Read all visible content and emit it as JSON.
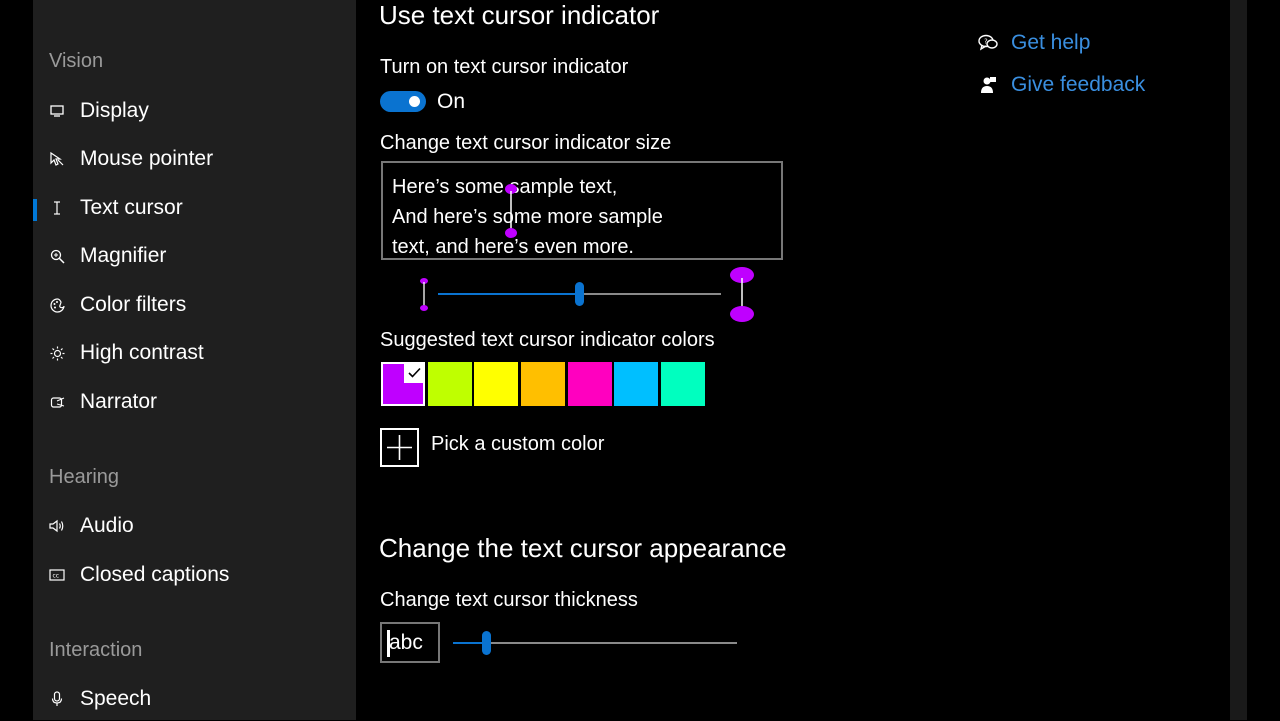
{
  "sidebar": {
    "sections": [
      {
        "title": "Vision",
        "items": [
          {
            "label": "Display",
            "icon": "display-icon"
          },
          {
            "label": "Mouse pointer",
            "icon": "mouse-pointer-icon"
          },
          {
            "label": "Text cursor",
            "icon": "text-cursor-icon",
            "active": true
          },
          {
            "label": "Magnifier",
            "icon": "magnifier-icon"
          },
          {
            "label": "Color filters",
            "icon": "color-filters-icon"
          },
          {
            "label": "High contrast",
            "icon": "high-contrast-icon"
          },
          {
            "label": "Narrator",
            "icon": "narrator-icon"
          }
        ]
      },
      {
        "title": "Hearing",
        "items": [
          {
            "label": "Audio",
            "icon": "audio-icon"
          },
          {
            "label": "Closed captions",
            "icon": "closed-captions-icon"
          }
        ]
      },
      {
        "title": "Interaction",
        "items": [
          {
            "label": "Speech",
            "icon": "microphone-icon"
          }
        ]
      }
    ]
  },
  "main": {
    "indicator_title": "Use text cursor indicator",
    "toggle": {
      "label": "Turn on text cursor indicator",
      "state": "On",
      "on": true
    },
    "size": {
      "label": "Change text cursor indicator size",
      "sample_lines": [
        "Here’s some sample text,",
        "And here’s some more sample",
        "text, and here’s even more."
      ],
      "slider_value": 0.5
    },
    "colors": {
      "label": "Suggested text cursor indicator colors",
      "swatches": [
        "#bf00ff",
        "#bfff00",
        "#ffff00",
        "#ffbf00",
        "#ff00bf",
        "#00bfff",
        "#00ffbf"
      ],
      "selected_index": 0
    },
    "custom_color_label": "Pick a custom color",
    "appearance_title": "Change the text cursor appearance",
    "thickness": {
      "label": "Change text cursor thickness",
      "preview_text": "abc",
      "slider_value": 0.1
    }
  },
  "links": {
    "get_help": "Get help",
    "give_feedback": "Give feedback"
  },
  "colors": {
    "accent": "#0a73d0",
    "link": "#3a8fe0",
    "cursor_indicator": "#bf00ff"
  }
}
